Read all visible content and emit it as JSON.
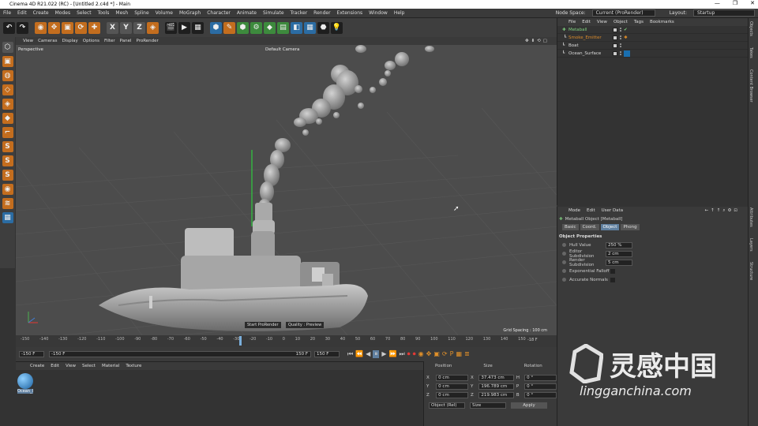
{
  "window": {
    "title": "Cinema 4D R21.022 (RC) - [Untitled 2.c4d *] - Main",
    "controls": [
      "—",
      "❐",
      "✕"
    ]
  },
  "menubar": {
    "items": [
      "File",
      "Edit",
      "Create",
      "Modes",
      "Select",
      "Tools",
      "Mesh",
      "Spline",
      "Volume",
      "MoGraph",
      "Character",
      "Animate",
      "Simulate",
      "Tracker",
      "Render",
      "Extensions",
      "Window",
      "Help"
    ],
    "node_space_label": "Node Space:",
    "node_space_value": "Current (ProRender)",
    "layout_label": "Layout:",
    "layout_value": "Startup"
  },
  "toolbar": {
    "items": [
      "↶",
      "↷",
      "◉",
      "✥",
      "▣",
      "⟳",
      "✚",
      "X",
      "Y",
      "Z",
      "◈",
      "🎬",
      "▶",
      "▦",
      "⬢",
      "✎",
      "⬢",
      "⚙",
      "◆",
      "▤",
      "◧",
      "▦",
      "⬣",
      "💡"
    ]
  },
  "viewport": {
    "menu": [
      "View",
      "Cameras",
      "Display",
      "Options",
      "Filter",
      "Panel",
      "ProRender"
    ],
    "label": "Perspective",
    "camera": "Default Camera",
    "buttons": [
      "Start ProRender",
      "Quality : Preview"
    ],
    "grid_spacing": "Grid Spacing : 100 cm"
  },
  "timeline": {
    "ticks": [
      "-150",
      "-140",
      "-130",
      "-120",
      "-110",
      "-100",
      "-90",
      "-80",
      "-70",
      "-60",
      "-50",
      "-40",
      "-30",
      "-20",
      "-10",
      "0",
      "10",
      "20",
      "30",
      "40",
      "50",
      "60",
      "70",
      "80",
      "90",
      "100",
      "110",
      "120",
      "130",
      "140",
      "150"
    ],
    "current": "-18 F"
  },
  "transport": {
    "start": "-150 F",
    "range_start": "-150 F",
    "range_end": "150 F",
    "end": "150 F"
  },
  "materials": {
    "menu": [
      "Create",
      "Edit",
      "View",
      "Select",
      "Material",
      "Texture"
    ],
    "items": [
      {
        "name": "Ocean_I"
      }
    ]
  },
  "coords": {
    "headers": [
      "Position",
      "Size",
      "Rotation"
    ],
    "rows": [
      {
        "axis": "X",
        "pos": "0 cm",
        "size_axis": "X",
        "size": "37.473 cm",
        "rot_axis": "H",
        "rot": "0 °"
      },
      {
        "axis": "Y",
        "pos": "0 cm",
        "size_axis": "Y",
        "size": "196.789 cm",
        "rot_axis": "P",
        "rot": "0 °"
      },
      {
        "axis": "Z",
        "pos": "0 cm",
        "size_axis": "Z",
        "size": "219.983 cm",
        "rot_axis": "B",
        "rot": "0 °"
      }
    ],
    "mode": "Object (Rel)",
    "size_mode": "Size",
    "apply": "Apply"
  },
  "object_manager": {
    "menu": [
      "File",
      "Edit",
      "View",
      "Object",
      "Tags",
      "Bookmarks"
    ],
    "objects": [
      {
        "name": "Metaball",
        "color": "#7fd07f"
      },
      {
        "name": "Smoke_Emitter",
        "color": "#d98a2a"
      },
      {
        "name": "Boat",
        "color": "#dddddd"
      },
      {
        "name": "Ocean_Surface",
        "color": "#dddddd"
      }
    ]
  },
  "attributes": {
    "menu": [
      "Mode",
      "Edit",
      "User Data"
    ],
    "title": "Metaball Object [Metaball]",
    "tabs": [
      "Basic",
      "Coord.",
      "Object",
      "Phong"
    ],
    "section": "Object Properties",
    "props": [
      {
        "label": "Hull Value",
        "value": "250 %"
      },
      {
        "label": "Editor Subdivision",
        "value": "2 cm"
      },
      {
        "label": "Render Subdivision",
        "value": "5 cm"
      },
      {
        "label": "Exponential Falloff",
        "value": ""
      },
      {
        "label": "Accurate Normals",
        "value": ""
      }
    ]
  },
  "right_strip": [
    "Objects",
    "Takes",
    "Content Browser",
    "Attributes",
    "Layers",
    "Structure"
  ],
  "watermark": {
    "brand": "灵感中国",
    "url": "lingganchina.com"
  },
  "colors": {
    "accent": "#d98a2a",
    "selected_tab": "#5f7f9f",
    "viewport": "#4c4c4c"
  }
}
